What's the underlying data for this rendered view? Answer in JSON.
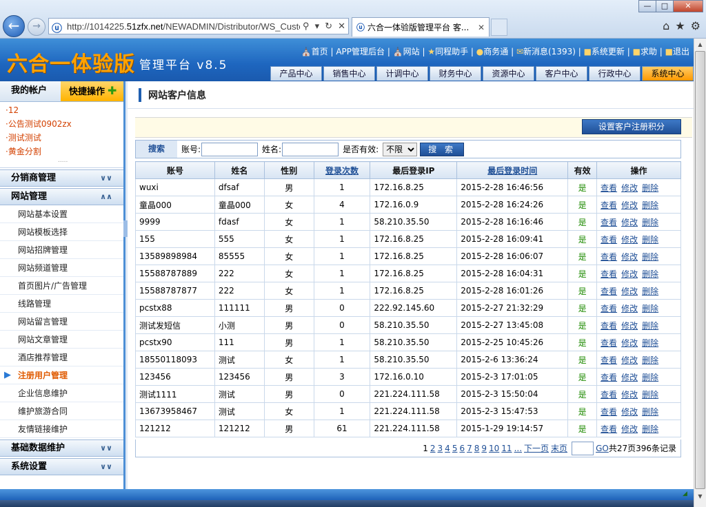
{
  "browser": {
    "url_prefix": "http://1014225.",
    "url_domain": "51zfx.net",
    "url_rest": "/NEWADMIN/Distributor/WS_Custo",
    "tab_title": "六合一体验版管理平台 客...",
    "win_min": "—",
    "win_max": "□",
    "win_close": "✕"
  },
  "app": {
    "logo": "六合一体验版",
    "subtitle": "管理平台 v8.5",
    "topnav": [
      "首页",
      "APP管理后台",
      "网站",
      "同程助手",
      "商务通",
      "新消息(1393)",
      "系统更新",
      "求助",
      "退出"
    ],
    "menu": [
      "产品中心",
      "销售中心",
      "计调中心",
      "财务中心",
      "资源中心",
      "客户中心",
      "行政中心",
      "系统中心"
    ],
    "menu_active_index": 7
  },
  "sidebar": {
    "account_label": "我的帐户",
    "quick_label": "快捷操作",
    "announcements": [
      "·12",
      "·公告测试0902zx",
      "·测试测试",
      "·黄金分割"
    ],
    "groups": [
      {
        "label": "分销商管理",
        "expanded": false
      },
      {
        "label": "网站管理",
        "expanded": true
      }
    ],
    "items": [
      "网站基本设置",
      "网站模板选择",
      "网站招牌管理",
      "网站频道管理",
      "首页图片/广告管理",
      "线路管理",
      "网站留言管理",
      "网站文章管理",
      "酒店推荐管理",
      "注册用户管理",
      "企业信息维护",
      "维护旅游合同",
      "友情链接维护"
    ],
    "active_item_index": 9,
    "bottom_groups": [
      "基础数据维护",
      "系统设置"
    ]
  },
  "main": {
    "title": "网站客户信息",
    "set_points_button": "设置客户注册积分",
    "search": {
      "label": "搜索",
      "account_label": "账号:",
      "name_label": "姓名:",
      "valid_label": "是否有效:",
      "valid_value": "不限",
      "button": "搜 索",
      "account_value": "",
      "name_value": ""
    },
    "columns": [
      "账号",
      "姓名",
      "性别",
      "登录次数",
      "最后登录IP",
      "最后登录时间",
      "有效",
      "操作"
    ],
    "rows": [
      [
        "wuxi",
        "dfsaf",
        "男",
        "1",
        "172.16.8.25",
        "2015-2-28 16:46:56",
        "是"
      ],
      [
        "童晶000",
        "童晶000",
        "女",
        "4",
        "172.16.0.9",
        "2015-2-28 16:24:26",
        "是"
      ],
      [
        "9999",
        "fdasf",
        "女",
        "1",
        "58.210.35.50",
        "2015-2-28 16:16:46",
        "是"
      ],
      [
        "155",
        "555",
        "女",
        "1",
        "172.16.8.25",
        "2015-2-28 16:09:41",
        "是"
      ],
      [
        "13589898984",
        "85555",
        "女",
        "1",
        "172.16.8.25",
        "2015-2-28 16:06:07",
        "是"
      ],
      [
        "15588787889",
        "222",
        "女",
        "1",
        "172.16.8.25",
        "2015-2-28 16:04:31",
        "是"
      ],
      [
        "15588787877",
        "222",
        "女",
        "1",
        "172.16.8.25",
        "2015-2-28 16:01:26",
        "是"
      ],
      [
        "pcstx88",
        "111111",
        "男",
        "0",
        "222.92.145.60",
        "2015-2-27 21:32:29",
        "是"
      ],
      [
        "测试发短信",
        "小测",
        "男",
        "0",
        "58.210.35.50",
        "2015-2-27 13:45:08",
        "是"
      ],
      [
        "pcstx90",
        "111",
        "男",
        "1",
        "58.210.35.50",
        "2015-2-25 10:45:26",
        "是"
      ],
      [
        "18550118093",
        "测试",
        "女",
        "1",
        "58.210.35.50",
        "2015-2-6 13:36:24",
        "是"
      ],
      [
        "123456",
        "123456",
        "男",
        "3",
        "172.16.0.10",
        "2015-2-3 17:01:05",
        "是"
      ],
      [
        "测试1111",
        "测试",
        "男",
        "0",
        "221.224.111.58",
        "2015-2-3 15:50:04",
        "是"
      ],
      [
        "13673958467",
        "测试",
        "女",
        "1",
        "221.224.111.58",
        "2015-2-3 15:47:53",
        "是"
      ],
      [
        "121212",
        "121212",
        "男",
        "61",
        "221.224.111.58",
        "2015-1-29 19:14:57",
        "是"
      ]
    ],
    "row_actions": [
      "查看",
      "修改",
      "删除"
    ],
    "pager": {
      "current": "1",
      "pages": [
        "2",
        "3",
        "4",
        "5",
        "6",
        "7",
        "8",
        "9",
        "10",
        "11",
        "..."
      ],
      "next": "下一页",
      "last": "末页",
      "go": "GO",
      "summary": "共27页396条记录"
    }
  }
}
